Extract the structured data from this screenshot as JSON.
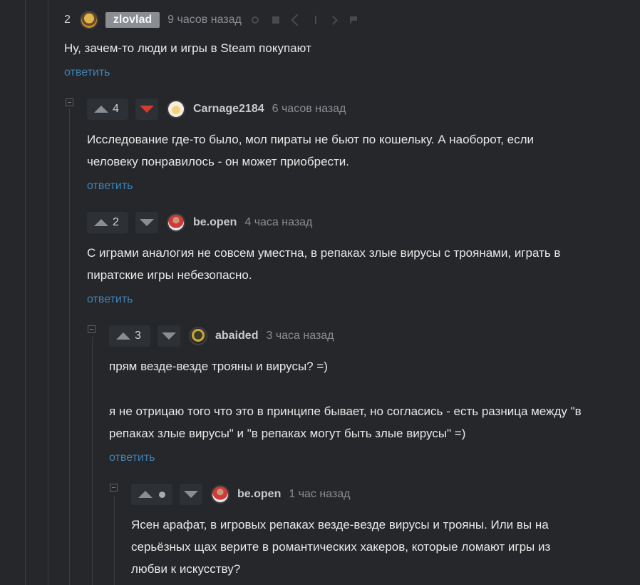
{
  "comments": [
    {
      "rating": "2",
      "user": "zlovlad",
      "time": "9 часов назад",
      "lines": [
        "Ну, зачем-то люди и игры в Steam покупают"
      ],
      "reply": "ответить"
    },
    {
      "rating": "4",
      "downvoted": true,
      "user": "Carnage2184",
      "time": "6 часов назад",
      "lines": [
        "Исследование где-то было, мол пираты не бьют по кошельку. А наоборот, если",
        "человеку понравилось - он может приобрести."
      ],
      "reply": "ответить"
    },
    {
      "rating": "2",
      "user": "be.open",
      "time": "4 часа назад",
      "lines": [
        "С играми аналогия не совсем уместна, в репаках злые вирусы с троянами, играть в",
        "пиратские игры небезопасно."
      ],
      "reply": "ответить"
    },
    {
      "rating": "3",
      "user": "abaided",
      "time": "3 часа назад",
      "lines": [
        "прям везде-везде трояны и вирусы? =)",
        "",
        "я не отрицаю того что это в принципе бывает, но согласись - есть разница между \"в",
        "репаках злые вирусы\" и \"в репаках могут быть злые вирусы\" =)"
      ],
      "reply": "ответить"
    },
    {
      "rating_icon": "dot-icon",
      "user": "be.open",
      "time": "1 час назад",
      "lines": [
        "Ясен арафат, в игровых репаках везде-везде вирусы и трояны. Или вы на",
        "серьёзных щах  верите в романтических хакеров, которые ломают игры из",
        "любви к искусству?"
      ]
    }
  ],
  "colors": {
    "downvote_active": "#d43b2f",
    "link": "#3f82b5",
    "background": "#25272a"
  }
}
